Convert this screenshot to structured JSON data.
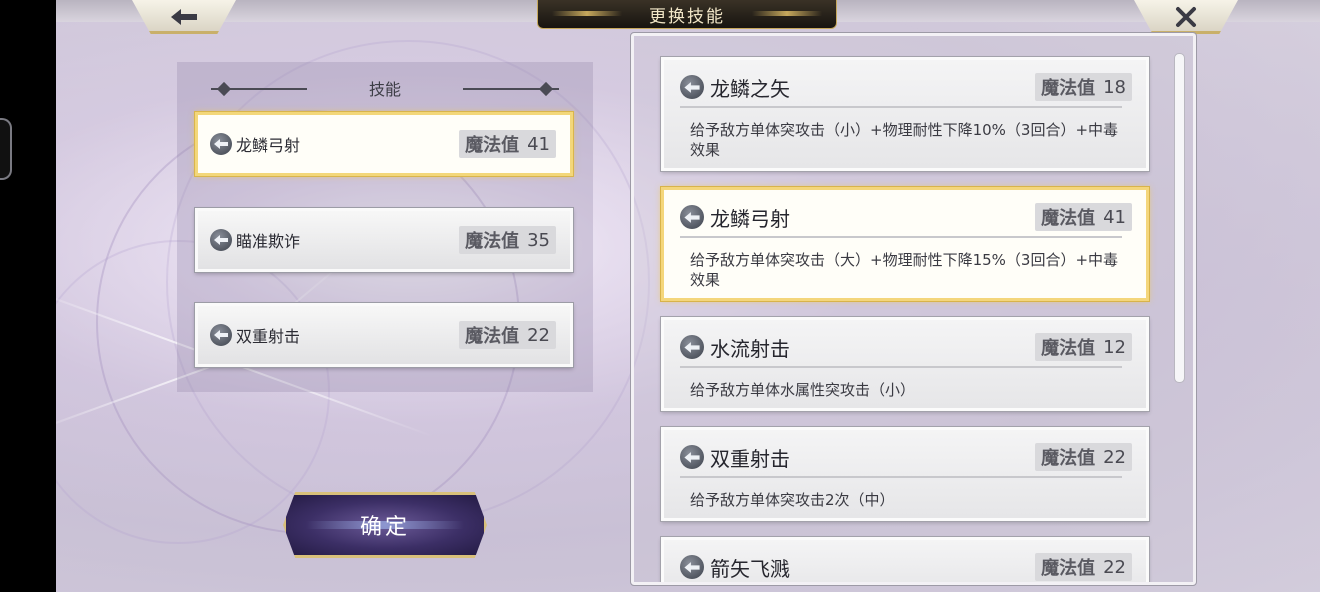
{
  "header": {
    "title": "更换技能",
    "back_icon": "back-arrow-icon",
    "close_icon": "close-x-icon"
  },
  "equipped": {
    "heading": "技能",
    "mp_label": "魔法值",
    "slots": [
      {
        "name": "龙鳞弓射",
        "mp": "41",
        "selected": true
      },
      {
        "name": "瞄准欺诈",
        "mp": "35",
        "selected": false
      },
      {
        "name": "双重射击",
        "mp": "22",
        "selected": false
      }
    ]
  },
  "confirm_label": "确定",
  "available": {
    "mp_label": "魔法值",
    "skills": [
      {
        "name": "龙鳞之矢",
        "mp": "18",
        "desc": "给予敌方单体突攻击（小）+物理耐性下降10%（3回合）+中毒效果",
        "selected": false
      },
      {
        "name": "龙鳞弓射",
        "mp": "41",
        "desc": "给予敌方单体突攻击（大）+物理耐性下降15%（3回合）+中毒效果",
        "selected": true
      },
      {
        "name": "水流射击",
        "mp": "12",
        "desc": "给予敌方单体水属性突攻击（小）",
        "selected": false
      },
      {
        "name": "双重射击",
        "mp": "22",
        "desc": "给予敌方单体突攻击2次（中）",
        "selected": false
      },
      {
        "name": "箭矢飞溅",
        "mp": "22",
        "desc": "",
        "selected": false
      }
    ]
  },
  "colors": {
    "accent_gold": "#d9b54c",
    "confirm_purple": "#3c2f66",
    "title_plate": "#171410"
  }
}
